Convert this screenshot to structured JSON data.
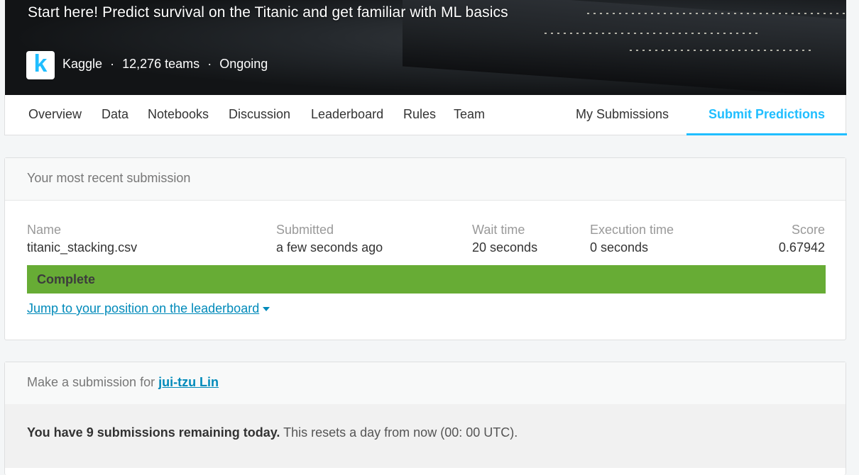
{
  "competition": {
    "title": "Start here! Predict survival on the Titanic and get familiar with ML basics",
    "logo_letter": "k",
    "host": "Kaggle",
    "separator": "·",
    "teams": "12,276 teams",
    "status": "Ongoing"
  },
  "tabs": [
    "Overview",
    "Data",
    "Notebooks",
    "Discussion",
    "Leaderboard",
    "Rules",
    "Team"
  ],
  "tabs_right": [
    "My Submissions",
    "Submit Predictions"
  ],
  "active_tab": "Submit Predictions",
  "recent_submission": {
    "header": "Your most recent submission",
    "columns": {
      "name": "Name",
      "submitted": "Submitted",
      "wait": "Wait time",
      "execution": "Execution time",
      "score": "Score"
    },
    "values": {
      "name": "titanic_stacking.csv",
      "submitted": "a few seconds ago",
      "wait": "20 seconds",
      "execution": "0 seconds",
      "score": "0.67942"
    },
    "status": "Complete",
    "jump_link": "Jump to your position on the leaderboard"
  },
  "make_submission": {
    "prefix": "Make a submission for ",
    "user": "jui-tzu Lin",
    "remaining_bold": "You have 9 submissions remaining today.",
    "remaining_rest": " This resets a day from now (00: 00 UTC)."
  },
  "colors": {
    "accent": "#20beff",
    "link": "#008aba",
    "complete": "#67ac35"
  }
}
